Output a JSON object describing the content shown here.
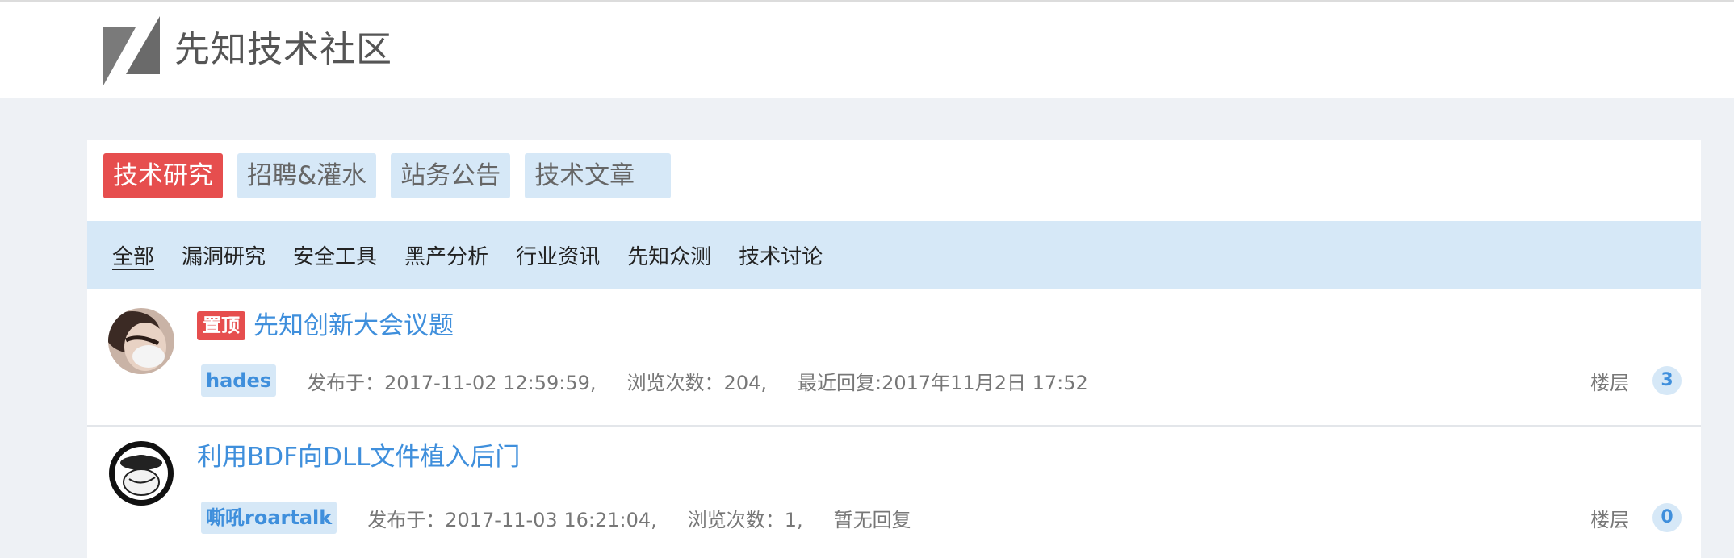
{
  "header": {
    "site_title": "先知技术社区"
  },
  "tabs": [
    {
      "label": "技术研究",
      "active": true
    },
    {
      "label": "招聘&灌水",
      "active": false
    },
    {
      "label": "站务公告",
      "active": false
    },
    {
      "label": "技术文章",
      "active": false
    }
  ],
  "subnav": [
    {
      "label": "全部",
      "active": true
    },
    {
      "label": "漏洞研究",
      "active": false
    },
    {
      "label": "安全工具",
      "active": false
    },
    {
      "label": "黑产分析",
      "active": false
    },
    {
      "label": "行业资讯",
      "active": false
    },
    {
      "label": "先知众测",
      "active": false
    },
    {
      "label": "技术讨论",
      "active": false
    }
  ],
  "posts": [
    {
      "pinned_label": "置顶",
      "title": "先知创新大会议题",
      "author": "hades",
      "published": "发布于：2017-11-02 12:59:59,",
      "views": "浏览次数：204,",
      "last_reply": "最近回复:2017年11月2日 17:52",
      "floor_label": "楼层",
      "floor_count": "3"
    },
    {
      "title": "利用BDF向DLL文件植入后门",
      "author": "嘶吼roartalk",
      "published": "发布于：2017-11-03 16:21:04,",
      "views": "浏览次数：1,",
      "last_reply": "暂无回复",
      "floor_label": "楼层",
      "floor_count": "0"
    }
  ],
  "colors": {
    "accent_red": "#e64e4e",
    "accent_blue": "#3f8fdc",
    "light_blue": "#d6e8f7"
  }
}
